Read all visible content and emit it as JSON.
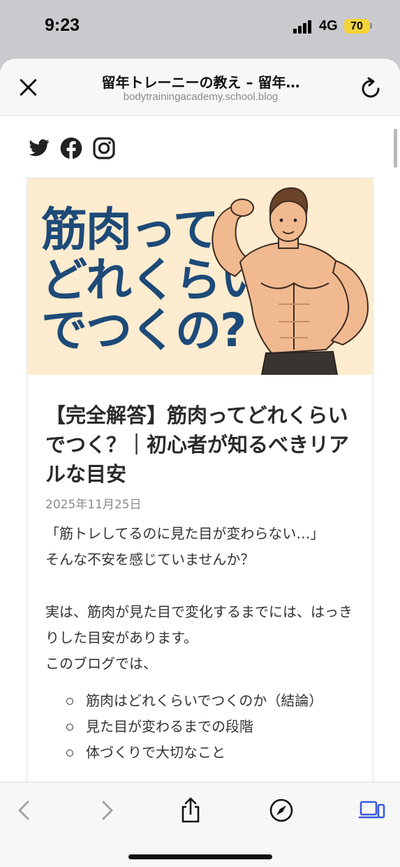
{
  "status_bar": {
    "time": "9:23",
    "network": "4G",
    "battery": "70",
    "battery_color": "#f2d33a"
  },
  "browser": {
    "page_title": "留年トレーニーの教え – 留年…",
    "url": "bodytrainingacademy.school.blog",
    "icons": [
      "close-icon",
      "reload-icon"
    ]
  },
  "social_icons": [
    "twitter-icon",
    "facebook-icon",
    "instagram-icon"
  ],
  "hero": {
    "lines": [
      "筋肉って",
      "どれくらい",
      "でつくの?"
    ],
    "text_color": "#1d4a78",
    "background": "#fdeccf"
  },
  "article": {
    "title": "【完全解答】筋肉ってどれくらいでつく？｜初心者が知るべきリアルな目安",
    "date": "2025年11月25日",
    "paragraph1_line1": "「筋トレしてるのに見た目が変わらない…」",
    "paragraph1_line2": "そんな不安を感じていませんか？",
    "paragraph2_line1": "実は、筋肉が見た目で変化するまでには、はっきりした目安があります。",
    "paragraph2_line2": "このブログでは、",
    "list_items": [
      "筋肉はどれくらいでつくのか（結論）",
      "見た目が変わるまでの段階",
      "体づくりで大切なこと"
    ]
  },
  "toolbar": {
    "icons": [
      "back-icon",
      "forward-icon",
      "share-icon",
      "compass-icon",
      "tabs-icon"
    ],
    "accent": "#3b5bdb"
  }
}
